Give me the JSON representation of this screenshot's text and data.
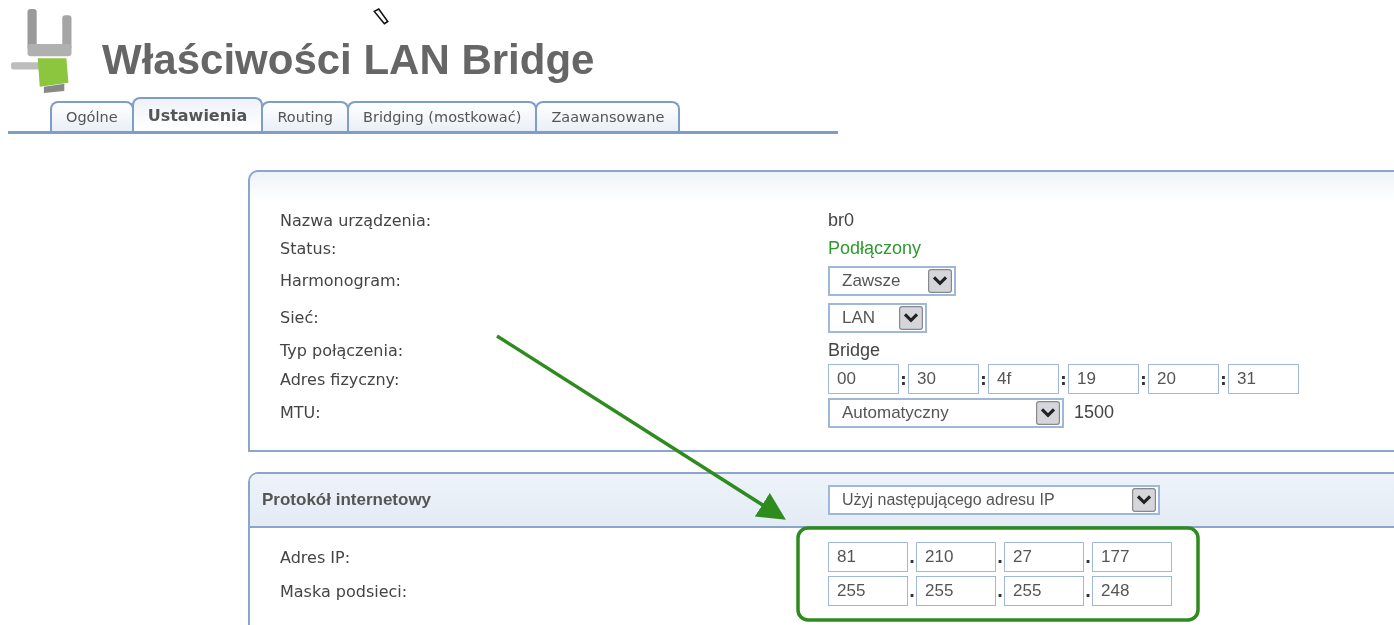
{
  "title": "Właściwości LAN Bridge",
  "tabs": [
    {
      "label": "Ogólne",
      "selected": false
    },
    {
      "label": "Ustawienia",
      "selected": true
    },
    {
      "label": "Routing",
      "selected": false
    },
    {
      "label": "Bridging (mostkować)",
      "selected": false
    },
    {
      "label": "Zaawansowane",
      "selected": false
    }
  ],
  "device_panel": {
    "rows": [
      {
        "kind": "text",
        "label": "Nazwa urządzenia:",
        "value": "br0"
      },
      {
        "kind": "status",
        "label": "Status:",
        "value": "Podłączony"
      },
      {
        "kind": "select",
        "label": "Harmonogram:",
        "value": "Zawsze"
      },
      {
        "kind": "select",
        "label": "Sieć:",
        "value": "LAN"
      },
      {
        "kind": "text",
        "label": "Typ połączenia:",
        "value": "Bridge"
      },
      {
        "kind": "mac",
        "label": "Adres fizyczny:",
        "separator": ":",
        "parts": [
          "00",
          "30",
          "4f",
          "19",
          "20",
          "31"
        ]
      },
      {
        "kind": "select",
        "label": "MTU:",
        "value": "Automatyczny",
        "reading": "1500"
      }
    ]
  },
  "ip_panel": {
    "title": "Protokół internetowy",
    "protocol": "Użyj następującego adresu IP",
    "separator": ".",
    "rows": [
      {
        "label": "Adres IP:",
        "octets": [
          "81",
          "210",
          "27",
          "177"
        ]
      },
      {
        "label": "Maska podsieci:",
        "octets": [
          "255",
          "255",
          "255",
          "248"
        ]
      }
    ]
  }
}
